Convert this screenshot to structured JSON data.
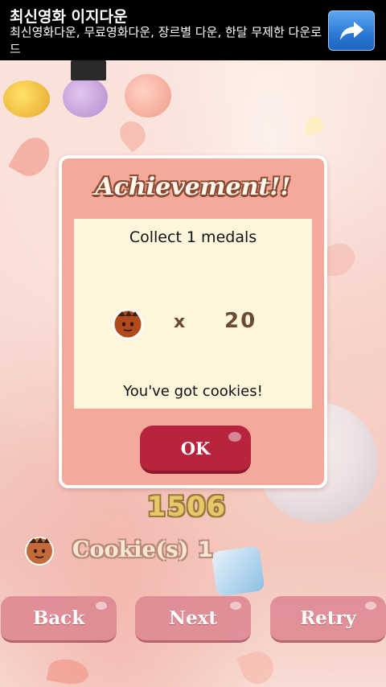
{
  "ad": {
    "title": "최신영화 이지다운",
    "description": "최신영화다운, 무료영화다운, 장르별 다운, 한달 무제한 다운로드",
    "button_icon": "share-arrow-icon"
  },
  "dialog": {
    "title": "Achievement!!",
    "headline": "Collect 1 medals",
    "reward_icon": "cookie-icon",
    "reward_times": "x",
    "reward_count": "20",
    "footer": "You've got cookies!",
    "ok_label": "OK"
  },
  "hud": {
    "score": "1506",
    "cookie_icon": "cookie-icon",
    "cookie_label": "Cookie(s)",
    "cookie_count": "1"
  },
  "buttons": {
    "back": "Back",
    "next": "Next",
    "retry": "Retry"
  },
  "colors": {
    "dialog_bg": "#f5a99a",
    "panel_bg": "#fef5dd",
    "ok_button": "#b8233e",
    "bottom_button": "#de8a94",
    "ad_button": "#2a78d6"
  }
}
